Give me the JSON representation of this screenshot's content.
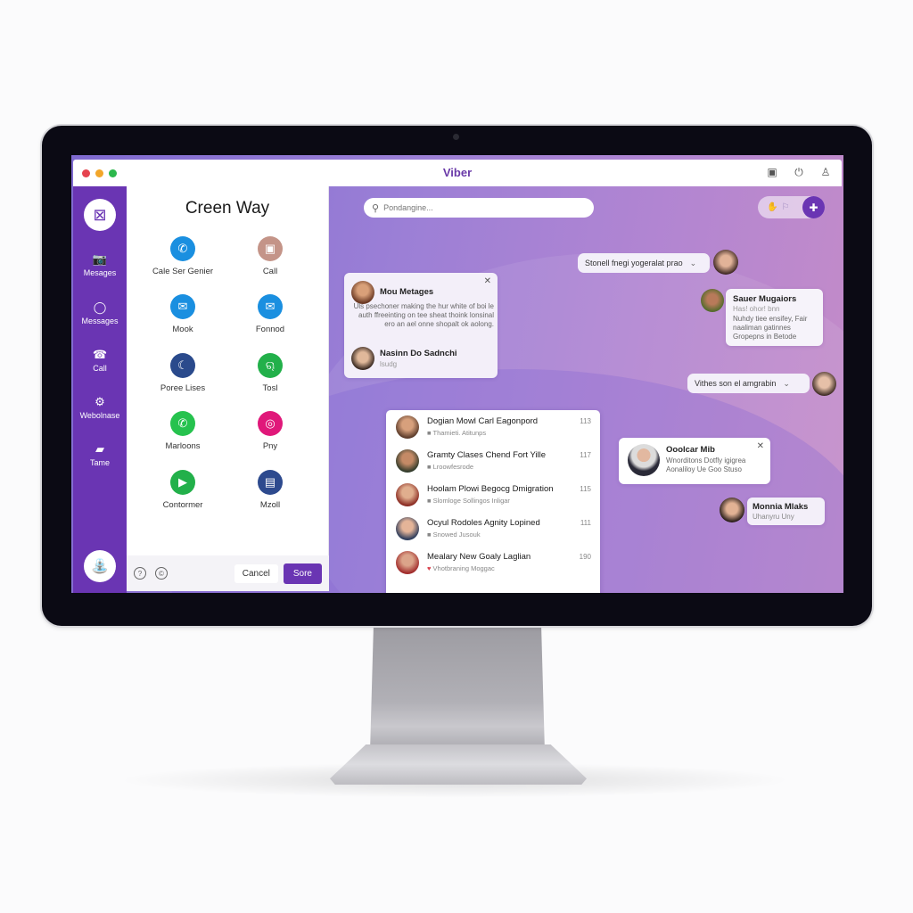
{
  "window": {
    "app_title": "Viber",
    "title_icons": [
      "calendar-icon",
      "power-icon",
      "user-icon"
    ]
  },
  "leftnav": {
    "logo_icon": "basket-icon",
    "items": [
      {
        "label": "Mesages",
        "icon": "camera-icon",
        "glyph": "📷"
      },
      {
        "label": "Messages",
        "icon": "chat-bubble-icon",
        "glyph": "◯"
      },
      {
        "label": "Call",
        "icon": "phone-icon",
        "glyph": "☎"
      },
      {
        "label": "Webolnase",
        "icon": "gear-icon",
        "glyph": "⚙"
      },
      {
        "label": "Tame",
        "icon": "briefcase-icon",
        "glyph": "▰"
      }
    ],
    "avatar_icon": "profile-icon"
  },
  "share_panel": {
    "title": "Creen Way",
    "items": [
      {
        "label": "Cale Ser Genier",
        "icon": "satellite-icon",
        "color": "#1a8fe0",
        "glyph": "✆"
      },
      {
        "label": "Call",
        "icon": "photo-icon",
        "color": "#c49488",
        "glyph": "▣"
      },
      {
        "label": "Mook",
        "icon": "mail-icon",
        "color": "#1a8fe0",
        "glyph": "✉"
      },
      {
        "label": "Fonnod",
        "icon": "mail-icon",
        "color": "#1a8fe0",
        "glyph": "✉"
      },
      {
        "label": "Poree Lises",
        "icon": "moon-icon",
        "color": "#2a4a8c",
        "glyph": "☾"
      },
      {
        "label": "Tosl",
        "icon": "ear-icon",
        "color": "#22b04a",
        "glyph": "ୠ"
      },
      {
        "label": "Marloons",
        "icon": "whatsapp-icon",
        "color": "#26c24e",
        "glyph": "✆"
      },
      {
        "label": "Pny",
        "icon": "instagram-icon",
        "color": "#e0187a",
        "glyph": "◎"
      },
      {
        "label": "Contormer",
        "icon": "video-icon",
        "color": "#22b04a",
        "glyph": "▶"
      },
      {
        "label": "Mzoll",
        "icon": "card-icon",
        "color": "#2d4a8e",
        "glyph": "▤"
      }
    ],
    "footer_icons": [
      "help-icon",
      "settings-icon"
    ],
    "cancel_label": "Cancel",
    "save_label": "Sore"
  },
  "main": {
    "search_placeholder": "Pondangine...",
    "top_actions": [
      "hand-icon",
      "pin-icon",
      "compose-icon"
    ],
    "message_card": {
      "sender": "Mou Metages",
      "body": "Uls psechoner making the hur white of boi le auth ffreeinting on tee sheat thoink lonsinal ero an ael onne shopalt ok aolong.",
      "second_sender": "Nasinn Do Sadnchi",
      "second_status": "lsudg"
    },
    "pill_top": {
      "text": "Stonell fnegi yogeralat prao"
    },
    "sauer_card": {
      "name": "Sauer Mugaiors",
      "line1": "Has! ohor! bnn",
      "line2": "Nuhdy tiee ensifey, Fair",
      "line3": "naaliman gatinnes",
      "line4": "Gropepns in Betode"
    },
    "pill_mid": {
      "text": "Vithes son el amgrabin"
    },
    "chats": [
      {
        "name": "Dogian Mowl Carl Eagonpord",
        "preview": "Thamieti. Atitunps",
        "count": "113",
        "marker": "■"
      },
      {
        "name": "Gramty Clases Chend Fort Yille",
        "preview": "Lroowfesrode",
        "count": "117",
        "marker": "■"
      },
      {
        "name": "Hoolam Plowi Begocg Dmigration",
        "preview": "Slomloge Sollingos Inligar",
        "count": "115",
        "marker": "■"
      },
      {
        "name": "Ocyul Rodoles Agnity Lopined",
        "preview": "Snowed Jusouk",
        "count": "111",
        "marker": "■"
      },
      {
        "name": "Mealary New Goaly Laglian",
        "preview": "Vhotbraning Moggac",
        "count": "190",
        "marker": "♥"
      }
    ],
    "oscar_card": {
      "name": "Ooolcar Mib",
      "line1": "Wnorditons Dotfly igigrea",
      "line2": "Aonaliloy Ue Goo Stuso"
    },
    "maria_card": {
      "name": "Monnia Mlaks",
      "status": "Uhanyru Uny"
    }
  }
}
